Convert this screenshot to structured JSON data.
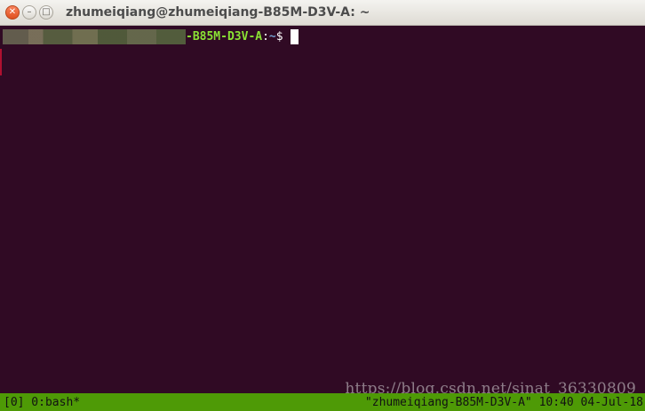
{
  "window": {
    "title": "zhumeiqiang@zhumeiqiang-B85M-D3V-A: ~",
    "close_glyph": "✕",
    "minimize_glyph": "–",
    "maximize_glyph": "□"
  },
  "terminal": {
    "prompt_host": "-B85M-D3V-A",
    "prompt_sep": ":",
    "prompt_dir": "~",
    "prompt_symbol": "$"
  },
  "status_bar": {
    "left": "[0] 0:bash*",
    "right": "\"zhumeiqiang-B85M-D3V-A\" 10:40 04-Jul-18"
  },
  "watermark": "https://blog.csdn.net/sinat_36330809",
  "colors": {
    "terminal_bg": "#300a24",
    "status_bg": "#4e9a06",
    "prompt_host": "#8ae234",
    "prompt_dir": "#729fcf"
  }
}
